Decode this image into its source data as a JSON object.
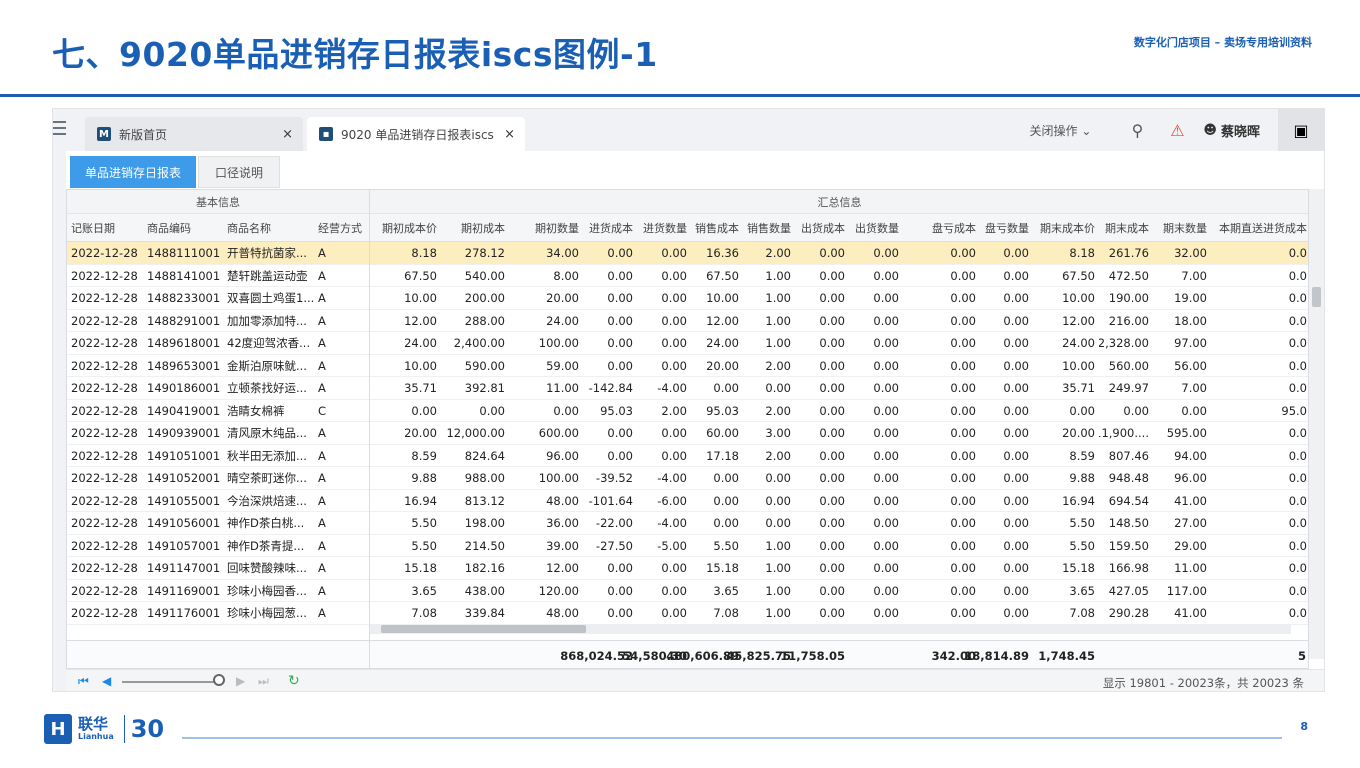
{
  "slide": {
    "title": "七、9020单品进销存日报表iscs图例-1",
    "subtitle": "数字化门店项目 – 卖场专用培训资料",
    "page_number": "8"
  },
  "logo": {
    "cn": "联华",
    "en": "Lianhua",
    "anniv": "30"
  },
  "app": {
    "tabs": [
      {
        "label": "新版首页",
        "close": "×"
      },
      {
        "label": "9020 单品进销存日报表iscs",
        "close": "×"
      }
    ],
    "close_ops": "关闭操作 ⌄",
    "user": "蔡晓晖",
    "subtabs": [
      "单品进销存日报表",
      "口径说明"
    ]
  },
  "grid": {
    "groups": [
      "基本信息",
      "汇总信息"
    ],
    "columns": [
      "记账日期",
      "商品编码",
      "商品名称",
      "经营方式",
      "期初成本价",
      "期初成本",
      "期初数量",
      "进货成本",
      "进货数量",
      "销售成本",
      "销售数量",
      "出货成本",
      "出货数量",
      "盘亏成本",
      "盘亏数量",
      "期末成本价",
      "期末成本",
      "期末数量",
      "本期直送进货成本"
    ],
    "rows": [
      [
        "2022-12-28",
        "1488111001",
        "开普特抗菌家...",
        "A",
        "8.18",
        "278.12",
        "34.00",
        "0.00",
        "0.00",
        "16.36",
        "2.00",
        "0.00",
        "0.00",
        "0.00",
        "0.00",
        "8.18",
        "261.76",
        "32.00",
        "0.0"
      ],
      [
        "2022-12-28",
        "1488141001",
        "楚轩跳盖运动壶",
        "A",
        "67.50",
        "540.00",
        "8.00",
        "0.00",
        "0.00",
        "67.50",
        "1.00",
        "0.00",
        "0.00",
        "0.00",
        "0.00",
        "67.50",
        "472.50",
        "7.00",
        "0.0"
      ],
      [
        "2022-12-28",
        "1488233001",
        "双喜圆土鸡蛋1...",
        "A",
        "10.00",
        "200.00",
        "20.00",
        "0.00",
        "0.00",
        "10.00",
        "1.00",
        "0.00",
        "0.00",
        "0.00",
        "0.00",
        "10.00",
        "190.00",
        "19.00",
        "0.0"
      ],
      [
        "2022-12-28",
        "1488291001",
        "加加零添加特...",
        "A",
        "12.00",
        "288.00",
        "24.00",
        "0.00",
        "0.00",
        "12.00",
        "1.00",
        "0.00",
        "0.00",
        "0.00",
        "0.00",
        "12.00",
        "216.00",
        "18.00",
        "0.0"
      ],
      [
        "2022-12-28",
        "1489618001",
        "42度迎驾浓香...",
        "A",
        "24.00",
        "2,400.00",
        "100.00",
        "0.00",
        "0.00",
        "24.00",
        "1.00",
        "0.00",
        "0.00",
        "0.00",
        "0.00",
        "24.00",
        "2,328.00",
        "97.00",
        "0.0"
      ],
      [
        "2022-12-28",
        "1489653001",
        "金斯泊原味鱿...",
        "A",
        "10.00",
        "590.00",
        "59.00",
        "0.00",
        "0.00",
        "20.00",
        "2.00",
        "0.00",
        "0.00",
        "0.00",
        "0.00",
        "10.00",
        "560.00",
        "56.00",
        "0.0"
      ],
      [
        "2022-12-28",
        "1490186001",
        "立顿茶找好运...",
        "A",
        "35.71",
        "392.81",
        "11.00",
        "-142.84",
        "-4.00",
        "0.00",
        "0.00",
        "0.00",
        "0.00",
        "0.00",
        "0.00",
        "35.71",
        "249.97",
        "7.00",
        "0.0"
      ],
      [
        "2022-12-28",
        "1490419001",
        "浩睛女棉裤",
        "C",
        "0.00",
        "0.00",
        "0.00",
        "95.03",
        "2.00",
        "95.03",
        "2.00",
        "0.00",
        "0.00",
        "0.00",
        "0.00",
        "0.00",
        "0.00",
        "0.00",
        "95.0"
      ],
      [
        "2022-12-28",
        "1490939001",
        "清风原木纯品...",
        "A",
        "20.00",
        "12,000.00",
        "600.00",
        "0.00",
        "0.00",
        "60.00",
        "3.00",
        "0.00",
        "0.00",
        "0.00",
        "0.00",
        "20.00",
        "11,900....",
        "595.00",
        "0.0"
      ],
      [
        "2022-12-28",
        "1491051001",
        "秋半田无添加...",
        "A",
        "8.59",
        "824.64",
        "96.00",
        "0.00",
        "0.00",
        "17.18",
        "2.00",
        "0.00",
        "0.00",
        "0.00",
        "0.00",
        "8.59",
        "807.46",
        "94.00",
        "0.0"
      ],
      [
        "2022-12-28",
        "1491052001",
        "晴空茶町迷你...",
        "A",
        "9.88",
        "988.00",
        "100.00",
        "-39.52",
        "-4.00",
        "0.00",
        "0.00",
        "0.00",
        "0.00",
        "0.00",
        "0.00",
        "9.88",
        "948.48",
        "96.00",
        "0.0"
      ],
      [
        "2022-12-28",
        "1491055001",
        "今治深烘焙速...",
        "A",
        "16.94",
        "813.12",
        "48.00",
        "-101.64",
        "-6.00",
        "0.00",
        "0.00",
        "0.00",
        "0.00",
        "0.00",
        "0.00",
        "16.94",
        "694.54",
        "41.00",
        "0.0"
      ],
      [
        "2022-12-28",
        "1491056001",
        "神作D茶白桃...",
        "A",
        "5.50",
        "198.00",
        "36.00",
        "-22.00",
        "-4.00",
        "0.00",
        "0.00",
        "0.00",
        "0.00",
        "0.00",
        "0.00",
        "5.50",
        "148.50",
        "27.00",
        "0.0"
      ],
      [
        "2022-12-28",
        "1491057001",
        "神作D茶青提...",
        "A",
        "5.50",
        "214.50",
        "39.00",
        "-27.50",
        "-5.00",
        "5.50",
        "1.00",
        "0.00",
        "0.00",
        "0.00",
        "0.00",
        "5.50",
        "159.50",
        "29.00",
        "0.0"
      ],
      [
        "2022-12-28",
        "1491147001",
        "回味赞酸辣味...",
        "A",
        "15.18",
        "182.16",
        "12.00",
        "0.00",
        "0.00",
        "15.18",
        "1.00",
        "0.00",
        "0.00",
        "0.00",
        "0.00",
        "15.18",
        "166.98",
        "11.00",
        "0.0"
      ],
      [
        "2022-12-28",
        "1491169001",
        "珍味小梅园香...",
        "A",
        "3.65",
        "438.00",
        "120.00",
        "0.00",
        "0.00",
        "3.65",
        "1.00",
        "0.00",
        "0.00",
        "0.00",
        "0.00",
        "3.65",
        "427.05",
        "117.00",
        "0.0"
      ],
      [
        "2022-12-28",
        "1491176001",
        "珍味小梅园葱...",
        "A",
        "7.08",
        "339.84",
        "48.00",
        "0.00",
        "0.00",
        "7.08",
        "1.00",
        "0.00",
        "0.00",
        "0.00",
        "0.00",
        "7.08",
        "290.28",
        "41.00",
        "0.0"
      ]
    ],
    "totals": [
      "868,024.52",
      "54,580.30",
      "480,606.89",
      "45,825.75",
      "11,758.05",
      "342.00",
      "18,814.89",
      "1,748.45",
      "5"
    ]
  },
  "pager": {
    "info": "显示 19801 - 20023条，共 20023 条"
  }
}
